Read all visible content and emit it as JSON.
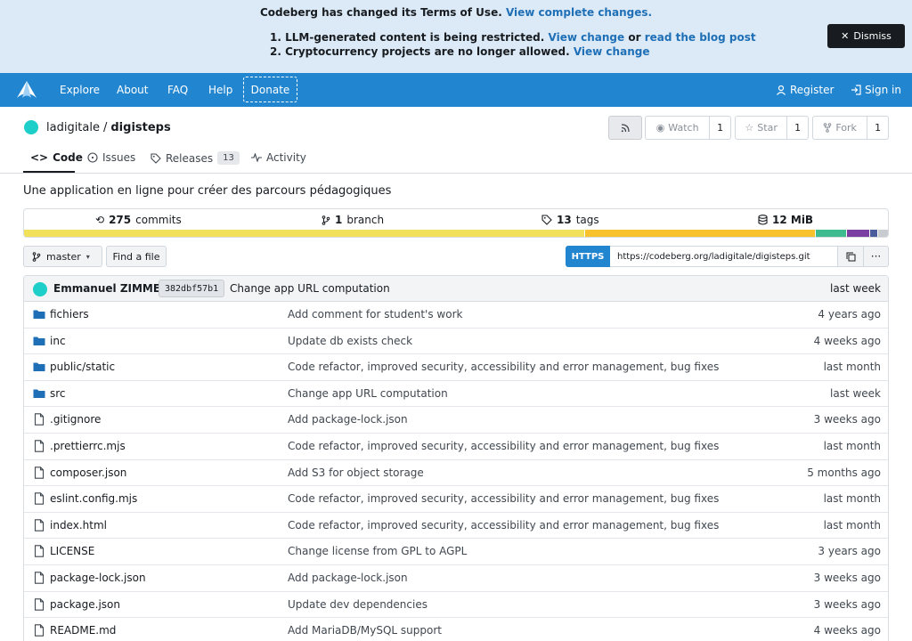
{
  "banner": {
    "line1_text": "Codeberg has changed its Terms of Use.",
    "line1_link": "View complete changes.",
    "item1_num": "1.",
    "item1_text": "LLM-generated content is being restricted.",
    "item1_link1": "View change",
    "item1_or": "or",
    "item1_link2": "read the blog post",
    "item2_num": "2.",
    "item2_text": "Cryptocurrency projects are no longer allowed.",
    "item2_link": "View change",
    "dismiss": "Dismiss"
  },
  "nav": {
    "explore": "Explore",
    "about": "About",
    "faq": "FAQ",
    "help": "Help",
    "donate": "Donate",
    "register": "Register",
    "signin": "Sign in"
  },
  "repo": {
    "owner": "ladigitale",
    "separator": "/",
    "name": "digisteps",
    "watch_label": "Watch",
    "watch_count": "1",
    "star_label": "Star",
    "star_count": "1",
    "fork_label": "Fork",
    "fork_count": "1",
    "description": "Une application en ligne pour créer des parcours pédagogiques"
  },
  "tabs": {
    "code": "Code",
    "issues": "Issues",
    "releases": "Releases",
    "releases_count": "13",
    "activity": "Activity"
  },
  "stats": {
    "commits_count": "275",
    "commits_label": "commits",
    "branches_count": "1",
    "branches_label": "branch",
    "tags_count": "13",
    "tags_label": "tags",
    "size_value": "12 MiB",
    "languages_fractions": [
      0.647,
      0.267,
      0.036,
      0.026,
      0.01,
      0.014
    ],
    "language_colors": [
      "#f1e05a",
      "#f7c22c",
      "#3ebb8f",
      "#7b3fa3",
      "#4a5c9c",
      "#c8ccd1"
    ]
  },
  "toolbar": {
    "branch": "master",
    "find_file": "Find a file",
    "clone_protocol": "HTTPS",
    "clone_url": "https://codeberg.org/ladigitale/digisteps.git"
  },
  "last_commit": {
    "author": "Emmanuel ZIMMERT",
    "sha": "382dbf57b1",
    "message": "Change app URL computation",
    "when": "last week"
  },
  "files": [
    {
      "type": "folder",
      "name": "fichiers",
      "message": "Add comment for student's work",
      "age": "4 years ago"
    },
    {
      "type": "folder",
      "name": "inc",
      "message": "Update db exists check",
      "age": "4 weeks ago"
    },
    {
      "type": "folder",
      "name": "public/static",
      "message": "Code refactor, improved security, accessibility and error management, bug fixes",
      "age": "last month"
    },
    {
      "type": "folder",
      "name": "src",
      "message": "Change app URL computation",
      "age": "last week"
    },
    {
      "type": "file",
      "name": ".gitignore",
      "message": "Add package-lock.json",
      "age": "3 weeks ago"
    },
    {
      "type": "file",
      "name": ".prettierrc.mjs",
      "message": "Code refactor, improved security, accessibility and error management, bug fixes",
      "age": "last month"
    },
    {
      "type": "file",
      "name": "composer.json",
      "message": "Add S3 for object storage",
      "age": "5 months ago"
    },
    {
      "type": "file",
      "name": "eslint.config.mjs",
      "message": "Code refactor, improved security, accessibility and error management, bug fixes",
      "age": "last month"
    },
    {
      "type": "file",
      "name": "index.html",
      "message": "Code refactor, improved security, accessibility and error management, bug fixes",
      "age": "last month"
    },
    {
      "type": "file",
      "name": "LICENSE",
      "message": "Change license from GPL to AGPL",
      "age": "3 years ago"
    },
    {
      "type": "file",
      "name": "package-lock.json",
      "message": "Add package-lock.json",
      "age": "3 weeks ago"
    },
    {
      "type": "file",
      "name": "package.json",
      "message": "Update dev dependencies",
      "age": "3 weeks ago"
    },
    {
      "type": "file",
      "name": "README.md",
      "message": "Add MariaDB/MySQL support",
      "age": "4 weeks ago"
    }
  ]
}
